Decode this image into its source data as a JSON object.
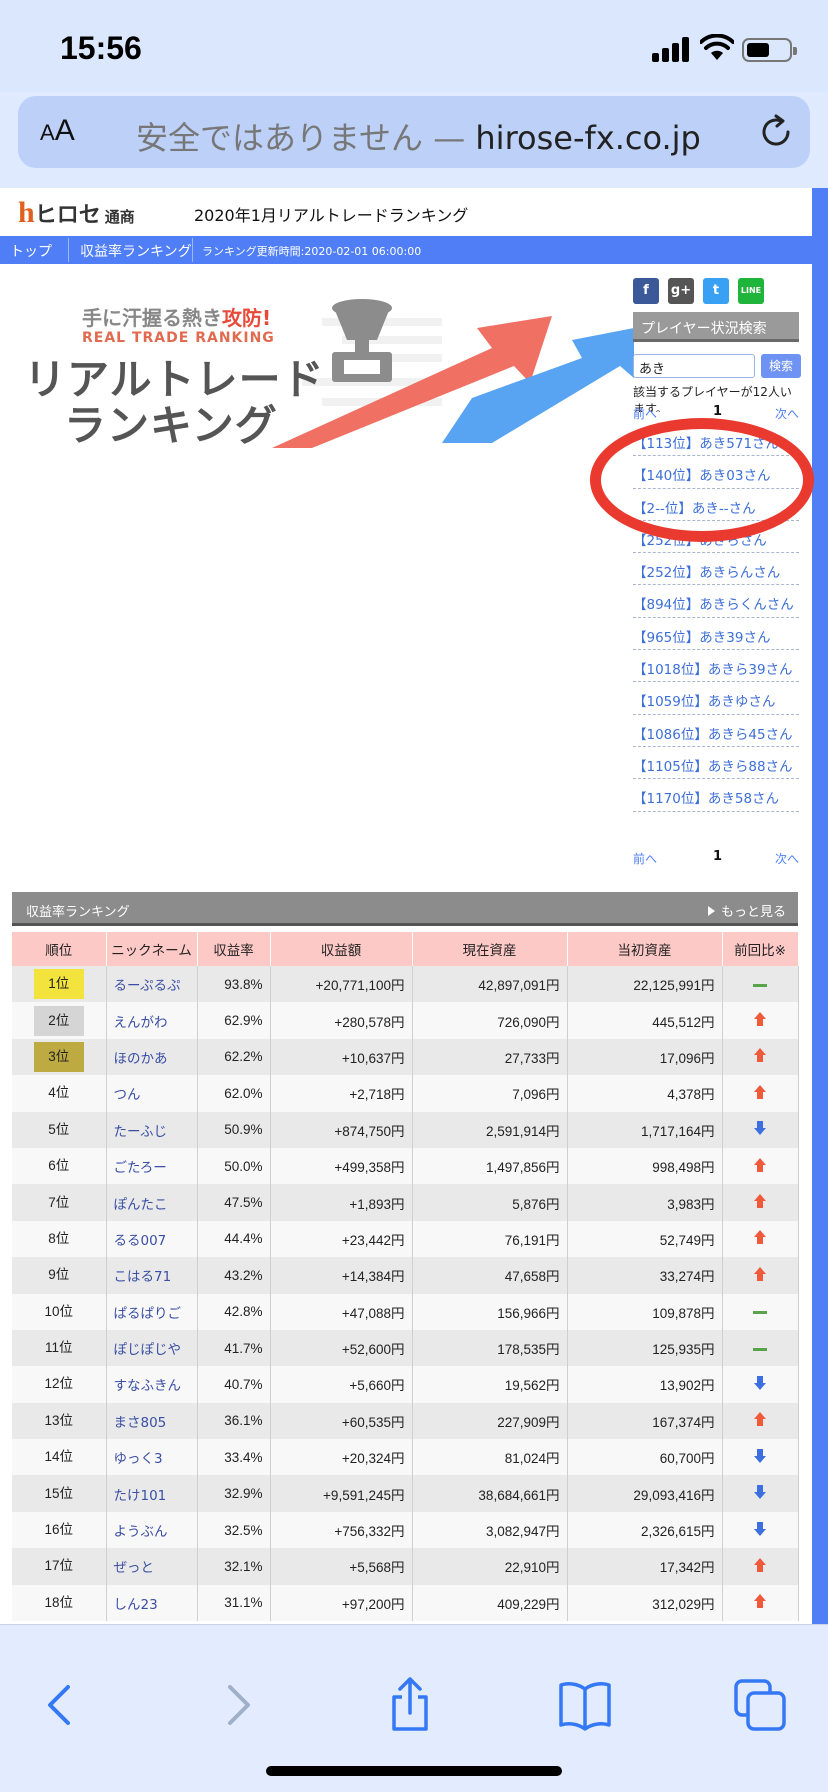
{
  "status": {
    "time": "15:56"
  },
  "browser": {
    "aa_small": "A",
    "aa_large": "A",
    "url_prefix": "安全ではありません —",
    "url_domain": "hirose-fx.co.jp"
  },
  "site": {
    "logo_h": "h",
    "logo_rest": "ヒロセ",
    "logo_sub": "通商",
    "title": "2020年1月リアルトレードランキング",
    "nav": [
      "トップ",
      "収益率ランキング",
      "ランキング更新時間:2020-02-01 06:00:00"
    ]
  },
  "banner": {
    "tag_a": "手に汗握る熱き",
    "tag_b": "攻防",
    "tag_c": "!",
    "sub": "REAL TRADE RANKING",
    "line1": "リアルトレード",
    "line2": "ランキング"
  },
  "social": [
    "f",
    "g+",
    "t",
    "LINE"
  ],
  "sidebar": {
    "title": "プレイヤー状況検索",
    "search_value": "あき",
    "search_button": "検索",
    "count_text": "該当するプレイヤーが12人います。",
    "pager": {
      "prev": "前へ",
      "page": "1",
      "next": "次へ"
    },
    "items": [
      "【113位】あき571さん",
      "【140位】あき03さん",
      "【2--位】あき--さん",
      "【252位】あきらさん",
      "【252位】あきらんさん",
      "【894位】あきらくんさん",
      "【965位】あき39さん",
      "【1018位】あきら39さん",
      "【1059位】あきゆさん",
      "【1086位】あきら45さん",
      "【1105位】あきら88さん",
      "【1170位】あき58さん"
    ]
  },
  "ranking": {
    "title": "収益率ランキング",
    "more": "もっと見る",
    "columns": [
      "順位",
      "ニックネーム",
      "収益率",
      "収益額",
      "現在資産",
      "当初資産",
      "前回比※"
    ],
    "colors": {
      "gold": "#f3e33d",
      "silver": "#d5d5d5",
      "bronze": "#bdaa40"
    },
    "rows": [
      {
        "rank": "1位",
        "name": "るーぷるぷ",
        "rate": "93.8%",
        "profit": "+20,771,100円",
        "current": "42,897,091円",
        "initial": "22,125,991円",
        "trend": "flat"
      },
      {
        "rank": "2位",
        "name": "えんがわ",
        "rate": "62.9%",
        "profit": "+280,578円",
        "current": "726,090円",
        "initial": "445,512円",
        "trend": "up"
      },
      {
        "rank": "3位",
        "name": "ほのかあ",
        "rate": "62.2%",
        "profit": "+10,637円",
        "current": "27,733円",
        "initial": "17,096円",
        "trend": "up"
      },
      {
        "rank": "4位",
        "name": "つん",
        "rate": "62.0%",
        "profit": "+2,718円",
        "current": "7,096円",
        "initial": "4,378円",
        "trend": "up"
      },
      {
        "rank": "5位",
        "name": "たーふじ",
        "rate": "50.9%",
        "profit": "+874,750円",
        "current": "2,591,914円",
        "initial": "1,717,164円",
        "trend": "down"
      },
      {
        "rank": "6位",
        "name": "ごたろー",
        "rate": "50.0%",
        "profit": "+499,358円",
        "current": "1,497,856円",
        "initial": "998,498円",
        "trend": "up"
      },
      {
        "rank": "7位",
        "name": "ぽんたこ",
        "rate": "47.5%",
        "profit": "+1,893円",
        "current": "5,876円",
        "initial": "3,983円",
        "trend": "up"
      },
      {
        "rank": "8位",
        "name": "るる007",
        "rate": "44.4%",
        "profit": "+23,442円",
        "current": "76,191円",
        "initial": "52,749円",
        "trend": "up"
      },
      {
        "rank": "9位",
        "name": "こはる71",
        "rate": "43.2%",
        "profit": "+14,384円",
        "current": "47,658円",
        "initial": "33,274円",
        "trend": "up"
      },
      {
        "rank": "10位",
        "name": "ぱるぱりご",
        "rate": "42.8%",
        "profit": "+47,088円",
        "current": "156,966円",
        "initial": "109,878円",
        "trend": "flat"
      },
      {
        "rank": "11位",
        "name": "ぽじぽじや",
        "rate": "41.7%",
        "profit": "+52,600円",
        "current": "178,535円",
        "initial": "125,935円",
        "trend": "flat"
      },
      {
        "rank": "12位",
        "name": "すなふきん",
        "rate": "40.7%",
        "profit": "+5,660円",
        "current": "19,562円",
        "initial": "13,902円",
        "trend": "down"
      },
      {
        "rank": "13位",
        "name": "まさ805",
        "rate": "36.1%",
        "profit": "+60,535円",
        "current": "227,909円",
        "initial": "167,374円",
        "trend": "up"
      },
      {
        "rank": "14位",
        "name": "ゆっく3",
        "rate": "33.4%",
        "profit": "+20,324円",
        "current": "81,024円",
        "initial": "60,700円",
        "trend": "down"
      },
      {
        "rank": "15位",
        "name": "たけ101",
        "rate": "32.9%",
        "profit": "+9,591,245円",
        "current": "38,684,661円",
        "initial": "29,093,416円",
        "trend": "down"
      },
      {
        "rank": "16位",
        "name": "ようぶん",
        "rate": "32.5%",
        "profit": "+756,332円",
        "current": "3,082,947円",
        "initial": "2,326,615円",
        "trend": "down"
      },
      {
        "rank": "17位",
        "name": "ぜっと",
        "rate": "32.1%",
        "profit": "+5,568円",
        "current": "22,910円",
        "initial": "17,342円",
        "trend": "up"
      },
      {
        "rank": "18位",
        "name": "しん23",
        "rate": "31.1%",
        "profit": "+97,200円",
        "current": "409,229円",
        "initial": "312,029円",
        "trend": "up"
      }
    ]
  },
  "toolbar": [
    "back-icon",
    "forward-icon",
    "share-icon",
    "bookmarks-icon",
    "tabs-icon"
  ]
}
